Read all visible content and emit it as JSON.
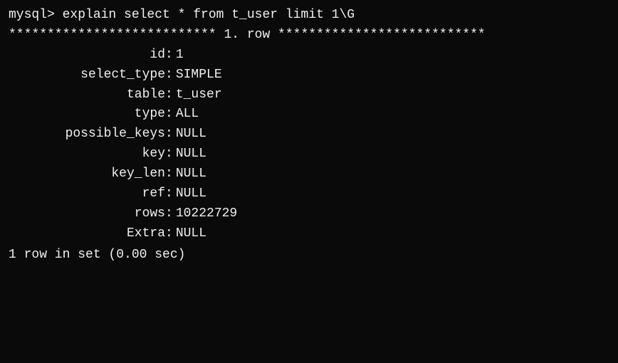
{
  "terminal": {
    "prompt_line": "mysql> explain select * from t_user limit 1\\G",
    "separator": "*************************** 1. row ***************************",
    "fields": [
      {
        "name": "id",
        "value": "1"
      },
      {
        "name": "select_type",
        "value": "SIMPLE"
      },
      {
        "name": "table",
        "value": "t_user"
      },
      {
        "name": "type",
        "value": "ALL"
      },
      {
        "name": "possible_keys",
        "value": "NULL"
      },
      {
        "name": "key",
        "value": "NULL"
      },
      {
        "name": "key_len",
        "value": "NULL"
      },
      {
        "name": "ref",
        "value": "NULL"
      },
      {
        "name": "rows",
        "value": "10222729"
      },
      {
        "name": "Extra",
        "value": "NULL"
      }
    ],
    "footer": "1 row in set (0.00 sec)"
  }
}
